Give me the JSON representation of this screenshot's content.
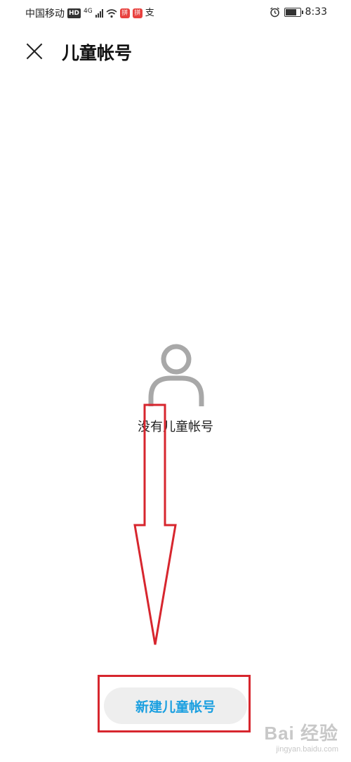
{
  "status_bar": {
    "carrier": "中国移动",
    "hd_badge": "HD",
    "network_type": "4G",
    "app_badge_1": "拼",
    "app_badge_2": "拼",
    "alipay_glyph": "支",
    "time": "8:33",
    "battery_level": 0.85
  },
  "header": {
    "title": "儿童帐号"
  },
  "empty_state": {
    "message": "没有儿童帐号",
    "icon": "person-outline-icon"
  },
  "actions": {
    "new_child_account_label": "新建儿童帐号"
  },
  "annotations": {
    "color": "#d7262e",
    "watermark_logo": "Bai 经验",
    "watermark_url": "jingyan.baidu.com"
  },
  "colors": {
    "accent": "#1a9fe0",
    "button_bg": "#eeeeee",
    "icon_gray": "#a8a8a8"
  }
}
